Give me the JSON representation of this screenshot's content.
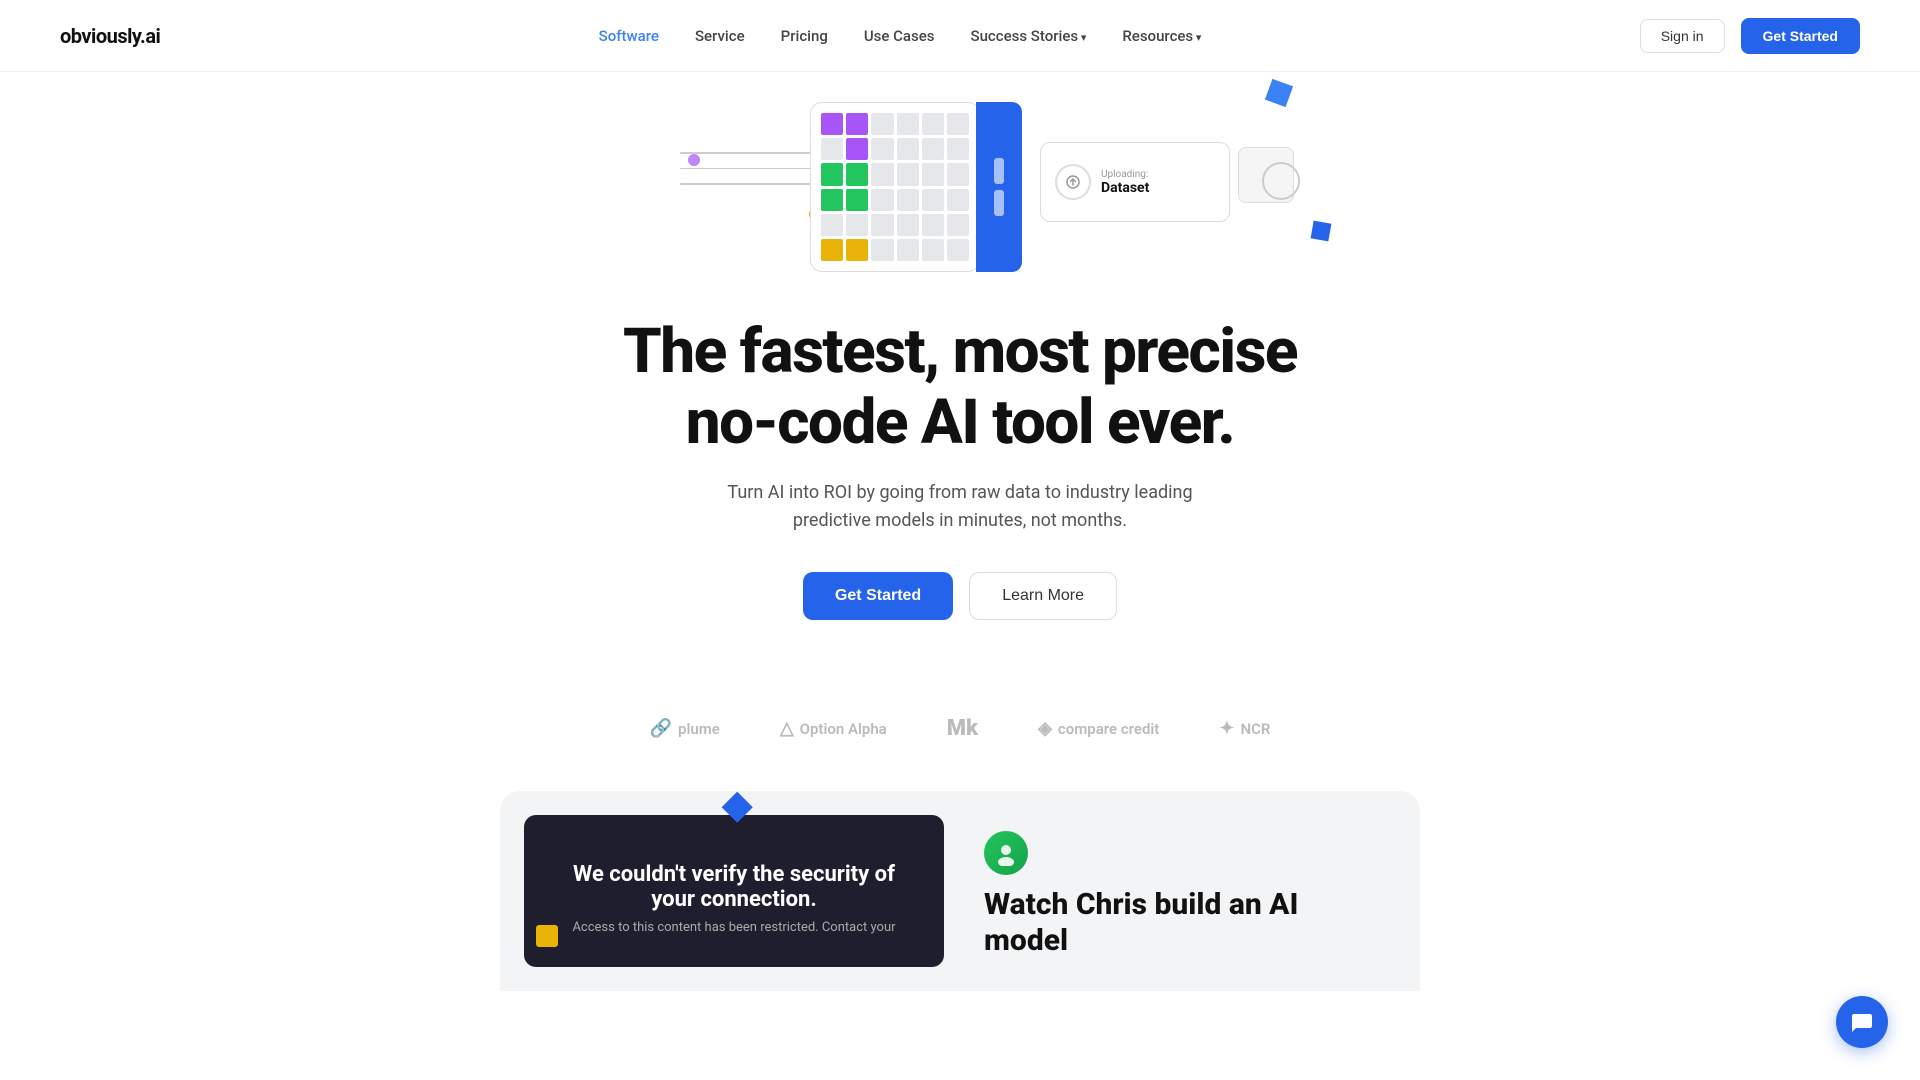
{
  "brand": {
    "name": "obviously.ai"
  },
  "nav": {
    "links": [
      {
        "id": "software",
        "label": "Software",
        "active": true,
        "hasDropdown": false
      },
      {
        "id": "service",
        "label": "Service",
        "active": false,
        "hasDropdown": false
      },
      {
        "id": "pricing",
        "label": "Pricing",
        "active": false,
        "hasDropdown": false
      },
      {
        "id": "use-cases",
        "label": "Use Cases",
        "active": false,
        "hasDropdown": false
      },
      {
        "id": "success-stories",
        "label": "Success Stories",
        "active": false,
        "hasDropdown": true
      },
      {
        "id": "resources",
        "label": "Resources",
        "active": false,
        "hasDropdown": true
      }
    ],
    "signin_label": "Sign in",
    "get_started_label": "Get Started"
  },
  "hero": {
    "title_line1": "The fastest, most precise",
    "title_line2": "no-code AI tool ever.",
    "subtitle": "Turn AI into ROI by going from raw data to industry leading predictive models in minutes, not months.",
    "cta_primary": "Get Started",
    "cta_secondary": "Learn More",
    "upload_label_small": "Uploading:",
    "upload_label_big": "Dataset"
  },
  "logos": [
    {
      "id": "plume",
      "icon": "🔗",
      "label": "plume"
    },
    {
      "id": "option-alpha",
      "icon": "△",
      "label": "Option Alpha"
    },
    {
      "id": "mk",
      "icon": "M",
      "label": "Mk"
    },
    {
      "id": "compare-credit",
      "icon": "◈",
      "label": "compare\ncredit"
    },
    {
      "id": "ncr",
      "icon": "✦",
      "label": "NCR"
    }
  ],
  "bottom": {
    "video_security_title": "We couldn't verify the security of your connection.",
    "video_security_sub": "Access to this content has been restricted. Contact your",
    "watch_title": "Watch Chris build an AI model",
    "avatar_emoji": "👤"
  },
  "colors": {
    "primary_blue": "#2563eb",
    "accent_blue": "#3b82f6",
    "yellow": "#eab308",
    "purple": "#c084fc",
    "green": "#22c55e",
    "grid_colors": [
      "#a855f7",
      "#a855f7",
      "#e5e7eb",
      "#e5e7eb",
      "#e5e7eb",
      "#e5e7eb",
      "#e5e7eb",
      "#a855f7",
      "#e5e7eb",
      "#e5e7eb",
      "#e5e7eb",
      "#e5e7eb",
      "#22c55e",
      "#22c55e",
      "#e5e7eb",
      "#e5e7eb",
      "#e5e7eb",
      "#e5e7eb",
      "#22c55e",
      "#22c55e",
      "#e5e7eb",
      "#e5e7eb",
      "#e5e7eb",
      "#e5e7eb",
      "#e5e7eb",
      "#e5e7eb",
      "#e5e7eb",
      "#e5e7eb",
      "#e5e7eb",
      "#e5e7eb",
      "#eab308",
      "#eab308",
      "#e5e7eb",
      "#e5e7eb",
      "#e5e7eb",
      "#e5e7eb"
    ]
  }
}
